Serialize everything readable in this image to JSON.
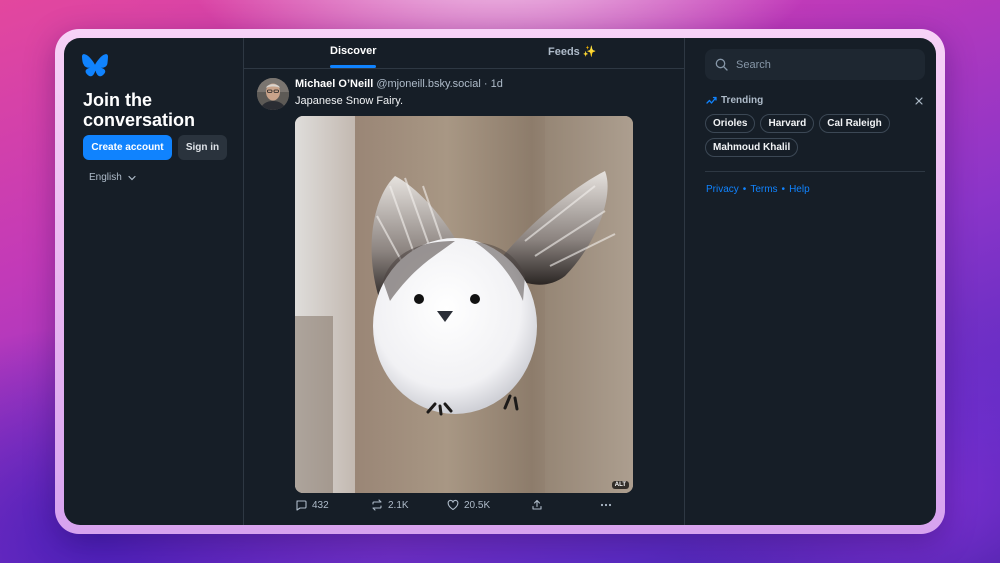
{
  "sidebar": {
    "logo": "butterfly-logo",
    "headline": "Join the conversation",
    "create_account_label": "Create account",
    "sign_in_label": "Sign in",
    "language": "English"
  },
  "feed": {
    "tabs": [
      {
        "label": "Discover",
        "active": true
      },
      {
        "label": "Feeds ✨",
        "active": false
      }
    ],
    "post": {
      "author": "Michael O’Neill",
      "handle": "@mjoneill.bsky.social",
      "time": "· 1d",
      "text": "Japanese Snow Fairy.",
      "alt_badge": "ALT",
      "replies": "432",
      "reposts": "2.1K",
      "likes": "20.5K"
    }
  },
  "right": {
    "search_placeholder": "Search",
    "trending_title": "Trending",
    "trending": [
      "Orioles",
      "Harvard",
      "Cal Raleigh",
      "Mahmoud Khalil"
    ],
    "links": [
      "Privacy",
      "Terms",
      "Help"
    ]
  },
  "colors": {
    "accent": "#1083fe",
    "background": "#161e27",
    "border": "#2e3843",
    "muted_text": "#aebbc9"
  }
}
